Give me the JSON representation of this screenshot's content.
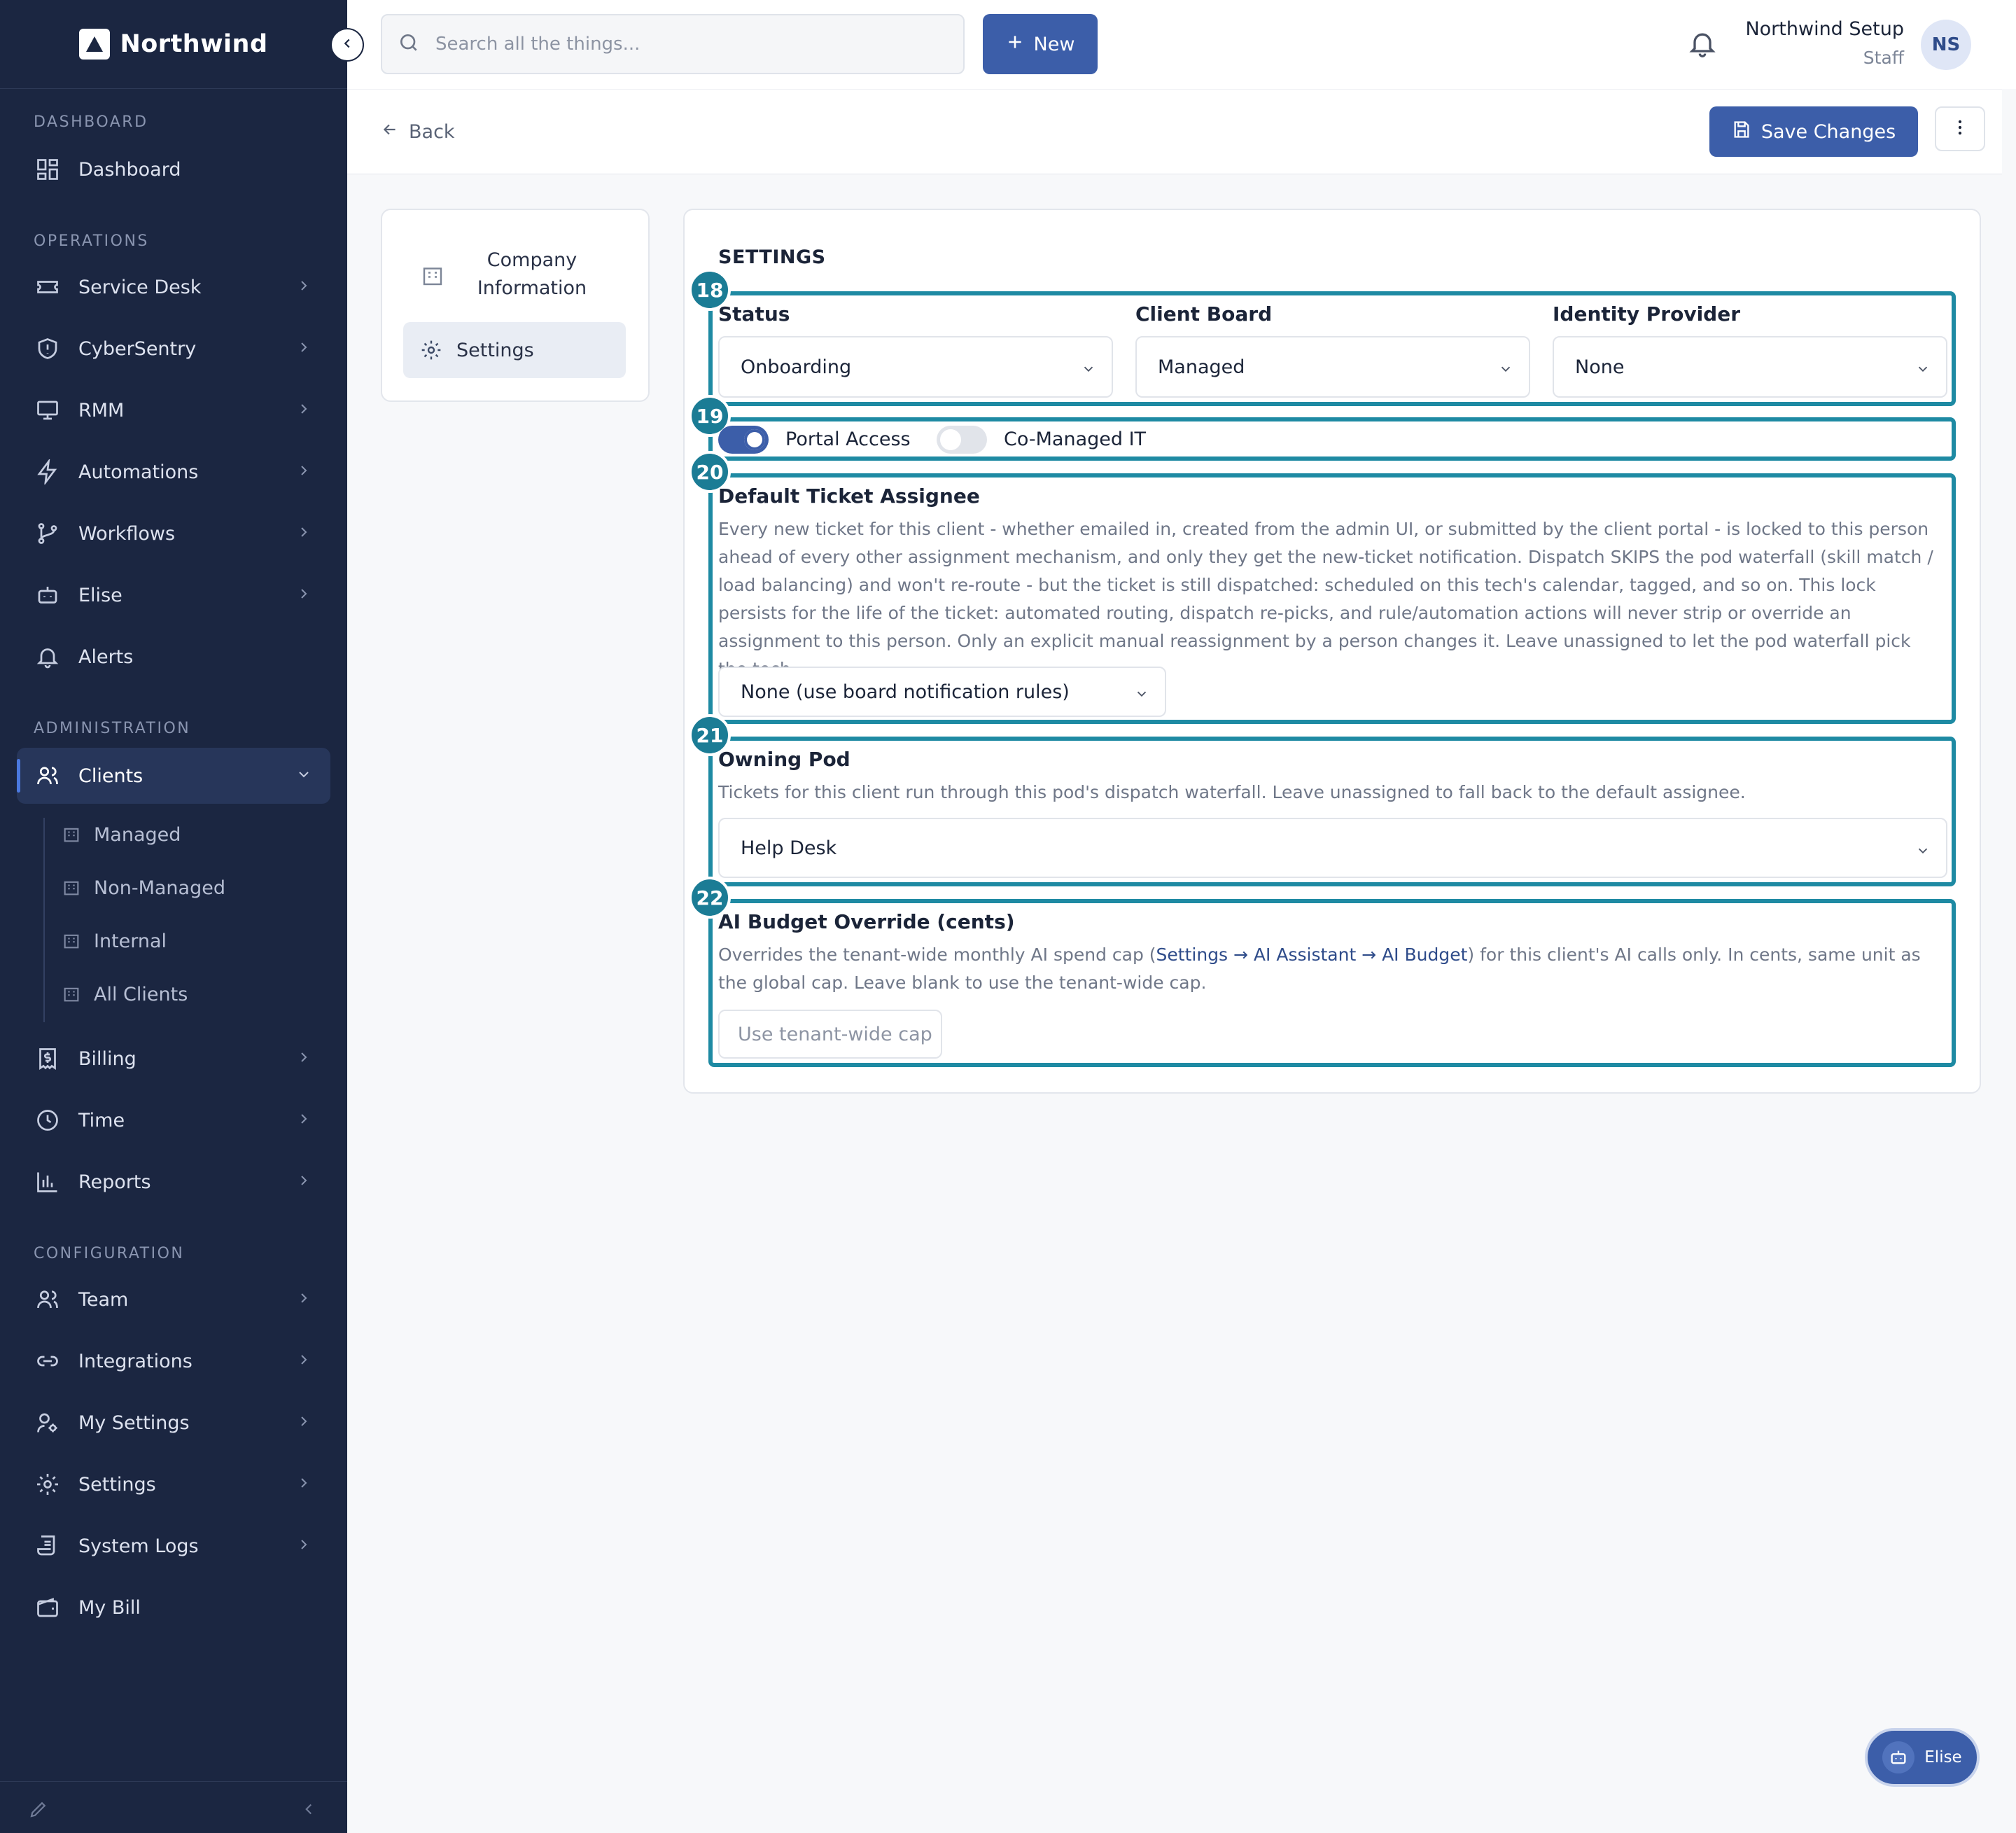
{
  "brand": {
    "name": "Northwind"
  },
  "sidebar": {
    "sections": {
      "dashboard": "DASHBOARD",
      "operations": "OPERATIONS",
      "administration": "ADMINISTRATION",
      "configuration": "CONFIGURATION"
    },
    "items": {
      "dashboard": "Dashboard",
      "service_desk": "Service Desk",
      "cybersentry": "CyberSentry",
      "rmm": "RMM",
      "automations": "Automations",
      "workflows": "Workflows",
      "elise": "Elise",
      "alerts": "Alerts",
      "clients": "Clients",
      "billing": "Billing",
      "time": "Time",
      "reports": "Reports",
      "team": "Team",
      "integrations": "Integrations",
      "my_settings": "My Settings",
      "settings": "Settings",
      "system_logs": "System Logs",
      "my_bill": "My Bill"
    },
    "client_subitems": [
      "Managed",
      "Non-Managed",
      "Internal",
      "All Clients"
    ]
  },
  "topbar": {
    "search_placeholder": "Search all the things...",
    "new_label": "New",
    "user_name": "Northwind Setup",
    "user_role": "Staff",
    "avatar_initials": "NS"
  },
  "subheader": {
    "back_label": "Back",
    "save_label": "Save Changes"
  },
  "side_menu": {
    "company_info": "Company Information",
    "settings": "Settings"
  },
  "settings": {
    "title": "SETTINGS",
    "badges": [
      "18",
      "19",
      "20",
      "21",
      "22"
    ],
    "status_label": "Status",
    "status_value": "Onboarding",
    "client_board_label": "Client Board",
    "client_board_value": "Managed",
    "idp_label": "Identity Provider",
    "idp_value": "None",
    "portal_access_label": "Portal Access",
    "portal_access_on": true,
    "co_managed_label": "Co-Managed IT",
    "co_managed_on": false,
    "default_assignee_label": "Default Ticket Assignee",
    "default_assignee_desc": "Every new ticket for this client - whether emailed in, created from the admin UI, or submitted by the client portal - is locked to this person ahead of every other assignment mechanism, and only they get the new-ticket notification. Dispatch SKIPS the pod waterfall (skill match / load balancing) and won't re-route - but the ticket is still dispatched: scheduled on this tech's calendar, tagged, and so on. This lock persists for the life of the ticket: automated routing, dispatch re-picks, and rule/automation actions will never strip or override an assignment to this person. Only an explicit manual reassignment by a person changes it. Leave unassigned to let the pod waterfall pick the tech.",
    "default_assignee_value": "None (use board notification rules)",
    "owning_pod_label": "Owning Pod",
    "owning_pod_desc": "Tickets for this client run through this pod's dispatch waterfall. Leave unassigned to fall back to the default assignee.",
    "owning_pod_value": "Help Desk",
    "ai_budget_label": "AI Budget Override (cents)",
    "ai_budget_desc_pre": "Overrides the tenant-wide monthly AI spend cap (",
    "ai_budget_desc_link": "Settings → AI Assistant → AI Budget",
    "ai_budget_desc_post": ") for this client's AI calls only. In cents, same unit as the global cap. Leave blank to use the tenant-wide cap.",
    "ai_budget_placeholder": "Use tenant-wide cap"
  },
  "fab": {
    "label": "Elise"
  },
  "colors": {
    "sidebar": "#1b2641",
    "accent": "#3c5ea9",
    "highlight": "#1e8aa3"
  }
}
